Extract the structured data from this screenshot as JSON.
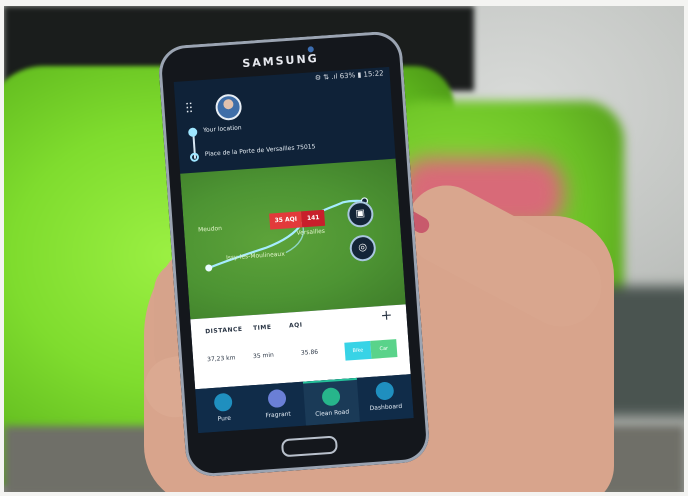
{
  "phone": {
    "brand": "SAMSUNG",
    "status": "⚙ ⇅ .ıl 63% ▮ 15:22"
  },
  "header": {
    "filters_icon": "sliders-icon",
    "avatar_icon": "user-avatar"
  },
  "route": {
    "from_label": "Your location",
    "to_label": "Place de la Porte de Versailles 75015"
  },
  "map": {
    "aqi_value": "35 AQI",
    "aqi_tag": "141",
    "label_place": "Versailles",
    "label_mid": "Issy-les-Moulineaux",
    "label_left": "Meudon"
  },
  "summary": {
    "plus_label": "+",
    "headers": {
      "distance": "DISTANCE",
      "time": "TIME",
      "aqi": "AQI"
    },
    "values": {
      "distance": "37,23 km",
      "time": "35 min",
      "aqi": "35.86"
    },
    "toggle": {
      "left": "Bike",
      "right": "Car"
    }
  },
  "tabs": [
    {
      "label": "Pure",
      "icon": "leaf-icon"
    },
    {
      "label": "Fragrant",
      "icon": "blossom-icon"
    },
    {
      "label": "Clean Road",
      "icon": "road-icon",
      "active": true
    },
    {
      "label": "Dashboard",
      "icon": "gauge-icon"
    }
  ],
  "colors": {
    "accent_cyan": "#38d3e6",
    "accent_green": "#5ad38a",
    "aqi_red": "#e23a3a",
    "screen_navy": "#0f2238"
  }
}
